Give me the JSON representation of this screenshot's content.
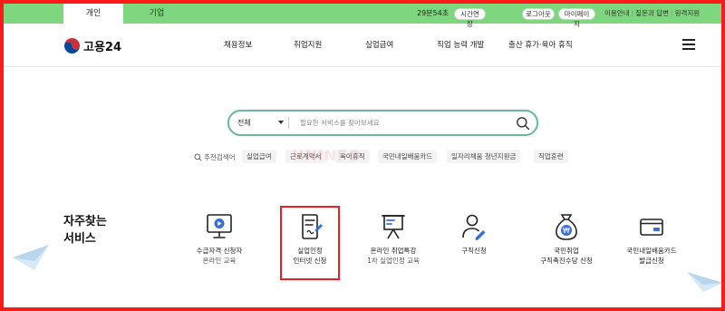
{
  "tabs": [
    "개인",
    "기업"
  ],
  "session": {
    "timer": "29분54초",
    "extend_label": "시간연장"
  },
  "auth": {
    "logout": "로그아웃",
    "mypage": "마이페이지"
  },
  "utility_links": [
    "이용안내",
    "질문과 답변",
    "원격지원"
  ],
  "logo": {
    "text": "고용24"
  },
  "nav": [
    "채용정보",
    "취업지원",
    "실업급여",
    "직업 능력 개발",
    "출산 휴가·육아 휴직"
  ],
  "search": {
    "scope": "전체",
    "placeholder": "필요한 서비스를 찾아보세요"
  },
  "recommended": {
    "label": "추천검색어",
    "keywords": [
      "실업급여",
      "근로계약서",
      "육아휴직",
      "국민내일배움카드",
      "일자리채움 청년지원금",
      "직업훈련"
    ]
  },
  "watermark": "HNINFO",
  "frequent": {
    "title_line1": "자주찾는",
    "title_line2": "서비스",
    "items": [
      {
        "icon": "monitor-play-icon",
        "label": "수급자격 신청자",
        "sub": "온라인 교육"
      },
      {
        "icon": "document-pen-icon",
        "label": "실업인정",
        "sub": "인터넷 신청"
      },
      {
        "icon": "presentation-board-icon",
        "label": "온라인 취업특강",
        "sub": "1차 실업인정 교육"
      },
      {
        "icon": "person-pen-icon",
        "label": "구직신청",
        "sub": ""
      },
      {
        "icon": "money-bag-icon",
        "label": "국민취업",
        "sub": "구직촉진수당 신청"
      },
      {
        "icon": "card-icon",
        "label": "국민내일배움카드",
        "sub": "발급신청"
      }
    ]
  },
  "colors": {
    "top_bar": "#7ed67f",
    "search_border": "#6fb5a8",
    "highlight": "#e8202a",
    "icon_accent": "#3a6fd8"
  }
}
